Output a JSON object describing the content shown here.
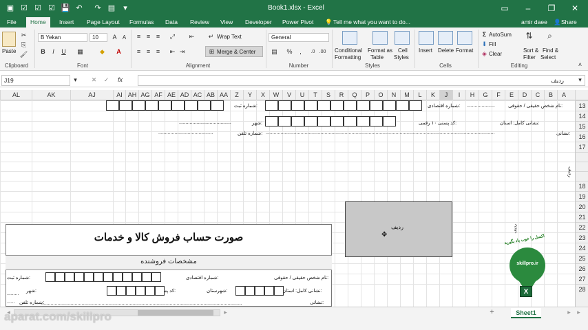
{
  "window": {
    "title": "Book1.xlsx  -  Excel"
  },
  "tabs": {
    "file": "File",
    "home": "Home",
    "insert": "Insert",
    "page_layout": "Page Layout",
    "formulas": "Formulas",
    "data": "Data",
    "review": "Review",
    "view": "View",
    "developer": "Developer",
    "power_pivot": "Power Pivot",
    "tell_me": "Tell me what you want to do...",
    "user": "amir daee",
    "share": "Share"
  },
  "ribbon": {
    "clipboard": {
      "label": "Clipboard",
      "paste": "Paste"
    },
    "font": {
      "label": "Font",
      "name": "B Yekan",
      "size": "10",
      "bold": "B",
      "italic": "I",
      "underline": "U"
    },
    "alignment": {
      "label": "Alignment",
      "wrap": "Wrap Text",
      "merge": "Merge & Center"
    },
    "number": {
      "label": "Number",
      "format": "General",
      "percent": "%",
      "comma": ","
    },
    "styles": {
      "label": "Styles",
      "conditional": "Conditional",
      "conditional2": "Formatting",
      "format_as": "Format as",
      "table": "Table",
      "cell_styles": "Cell",
      "cell_styles2": "Styles"
    },
    "cells": {
      "label": "Cells",
      "insert": "Insert",
      "delete": "Delete",
      "format": "Format"
    },
    "editing": {
      "label": "Editing",
      "autosum": "AutoSum",
      "fill": "Fill",
      "clear": "Clear",
      "sort": "Sort &",
      "filter": "Filter",
      "find": "Find &",
      "select": "Select"
    }
  },
  "formula_bar": {
    "name_box": "J19",
    "fx": "fx",
    "content": "ردیف"
  },
  "columns": [
    "AL",
    "AK",
    "AJ",
    "AI",
    "AH",
    "AG",
    "AF",
    "AE",
    "AD",
    "AC",
    "AB",
    "AA",
    "Z",
    "Y",
    "X",
    "W",
    "V",
    "U",
    "T",
    "S",
    "R",
    "Q",
    "P",
    "O",
    "N",
    "M",
    "L",
    "K",
    "J",
    "I",
    "H",
    "G",
    "F",
    "E",
    "D",
    "C",
    "B",
    "A"
  ],
  "rows": [
    "13",
    "14",
    "15",
    "16",
    "17",
    "",
    "",
    "",
    "18",
    "19",
    "20",
    "21",
    "22",
    "23",
    "24",
    "25",
    "26",
    "27",
    "28"
  ],
  "form_top": {
    "r13_right": "نام شخص حقیقی / حقوقی:",
    "r13_mid": "شماره اقتصادی:",
    "r13_left": "شماره ثبت:",
    "r15_right": "نشانی کامل: استان:",
    "r15_mid": "کد پستی ۱۰ رقمی:",
    "r15_left": "شهر:",
    "r16_right": "نشانی:",
    "r16_left": "شماره تلفن:",
    "vertical_label": "ردیف"
  },
  "selected_shape": {
    "text": "ردیف"
  },
  "invoice": {
    "title": "صورت حساب فروش کالا و خدمات",
    "seller": "مشخصات فروشنده",
    "r1_right": "نام شخص حقیقی / حقوقی:",
    "r1_mid": "شماره اقتصادی:",
    "r1_left": "شماره ثبت:",
    "r2_right": "نشانی کامل:  استان:",
    "r2_mid1": "شهرستان:",
    "r2_mid2": "کد پستی ۱۰ رقمی:",
    "r2_left": "شهر:",
    "r3_right": "نشانی:",
    "r3_left": "شماره تلفن:"
  },
  "logo": {
    "caption": "skillpro.ir",
    "slogan": "اکسل را خوب یاد بگیرید",
    "vertical": "ردیف",
    "badge": "X"
  },
  "sheet": {
    "name": "Sheet1",
    "add": "+"
  },
  "watermark": "aparat.com/skillpro",
  "colors": {
    "excel_green": "#217346",
    "selection": "#c8c8c8"
  }
}
